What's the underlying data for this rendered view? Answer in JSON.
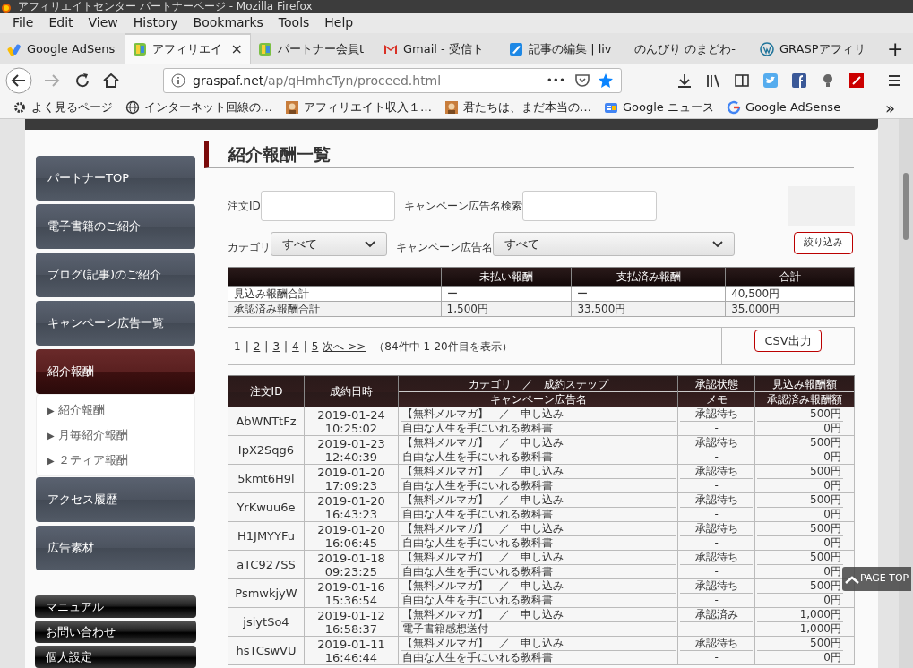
{
  "window": {
    "title": "アフィリエイトセンター パートナーページ - Mozilla Firefox"
  },
  "menu": [
    "File",
    "Edit",
    "View",
    "History",
    "Bookmarks",
    "Tools",
    "Help"
  ],
  "tabs": [
    {
      "label": "Google AdSens",
      "selected": false
    },
    {
      "label": "アフィリエイ",
      "selected": true,
      "close": "×"
    },
    {
      "label": "パートナー会員t",
      "selected": false
    },
    {
      "label": "Gmail - 受信ト",
      "selected": false
    },
    {
      "label": "記事の編集 | liv",
      "selected": false
    },
    {
      "label": "のんびり のまどわ‐",
      "selected": false
    },
    {
      "label": "GRASPアフィリ",
      "selected": false
    }
  ],
  "new_tab": "+",
  "address": {
    "host": "graspaf.net",
    "path": "/ap/qHmhcTyn/proceed.html",
    "more": "•••"
  },
  "bookmarks": [
    "よく見るページ",
    "インターネット回線の…",
    "アフィリエイト収入１…",
    "君たちは、まだ本当の…",
    "Google ニュース",
    "Google AdSense"
  ],
  "bookmarks_more": "»",
  "sidebar": {
    "items": [
      {
        "label": "パートナーTOP",
        "selected": false
      },
      {
        "label": "電子書籍のご紹介",
        "selected": false
      },
      {
        "label": "ブログ(記事)のご紹介",
        "selected": false
      },
      {
        "label": "キャンペーン広告一覧",
        "selected": false
      },
      {
        "label": "紹介報酬",
        "selected": true,
        "children": [
          "紹介報酬",
          "月毎紹介報酬",
          "２ティア報酬"
        ]
      },
      {
        "label": "アクセス履歴",
        "selected": false
      },
      {
        "label": "広告素材",
        "selected": false
      }
    ],
    "bullet": "▶",
    "footer_items": [
      "マニュアル",
      "お問い合わせ",
      "個人設定"
    ]
  },
  "heading": "紹介報酬一覧",
  "filters": {
    "order_id_label": "注文ID",
    "campaign_search_label": "キャンペーン広告名検索",
    "category_label": "カテゴリ",
    "category_value": "すべて",
    "campaign_label": "キャンペーン広告名",
    "campaign_value": "すべて",
    "submit": "絞り込み"
  },
  "summary": {
    "columns": [
      "",
      "未払い報酬",
      "支払済み報酬",
      "合計"
    ],
    "rows": [
      [
        "見込み報酬合計",
        "ー",
        "ー",
        "40,500円"
      ],
      [
        "承認済み報酬合計",
        "1,500円",
        "33,500円",
        "35,000円"
      ]
    ]
  },
  "pagination": {
    "pages": [
      {
        "label": "1",
        "selected": true
      },
      {
        "label": "2",
        "selected": false
      },
      {
        "label": "3",
        "selected": false
      },
      {
        "label": "4",
        "selected": false
      },
      {
        "label": "5",
        "selected": false
      }
    ],
    "separator": "|",
    "next": "次へ >>",
    "count": "（84件中 1-20件目を表示）",
    "csv": "CSV出力"
  },
  "table": {
    "header_rows": [
      [
        "注文ID",
        "成約日時",
        "カテゴリ　／　成約ステップ",
        "承認状態",
        "見込み報酬額"
      ],
      [
        "キャンペーン広告名",
        "メモ",
        "承認済み報酬額"
      ]
    ],
    "rows": [
      [
        [
          "AbWNTtFz"
        ],
        [
          "2019-01-24",
          "10:25:02"
        ],
        [
          "【無料メルマガ】　／　申し込み",
          "自由な人生を手にいれる教科書"
        ],
        [
          "承認待ち",
          "-"
        ],
        [
          "500円",
          "0円"
        ]
      ],
      [
        [
          "IpX2Sqg6"
        ],
        [
          "2019-01-23",
          "12:40:39"
        ],
        [
          "【無料メルマガ】　／　申し込み",
          "自由な人生を手にいれる教科書"
        ],
        [
          "承認待ち",
          "-"
        ],
        [
          "500円",
          "0円"
        ]
      ],
      [
        [
          "5kmt6H9l"
        ],
        [
          "2019-01-20",
          "17:09:23"
        ],
        [
          "【無料メルマガ】　／　申し込み",
          "自由な人生を手にいれる教科書"
        ],
        [
          "承認待ち",
          "-"
        ],
        [
          "500円",
          "0円"
        ]
      ],
      [
        [
          "YrKwuu6e"
        ],
        [
          "2019-01-20",
          "16:43:23"
        ],
        [
          "【無料メルマガ】　／　申し込み",
          "自由な人生を手にいれる教科書"
        ],
        [
          "承認待ち",
          "-"
        ],
        [
          "500円",
          "0円"
        ]
      ],
      [
        [
          "H1JMYYFu"
        ],
        [
          "2019-01-20",
          "16:06:45"
        ],
        [
          "【無料メルマガ】　／　申し込み",
          "自由な人生を手にいれる教科書"
        ],
        [
          "承認待ち",
          "-"
        ],
        [
          "500円",
          "0円"
        ]
      ],
      [
        [
          "aTC927SS"
        ],
        [
          "2019-01-18",
          "09:23:25"
        ],
        [
          "【無料メルマガ】　／　申し込み",
          "自由な人生を手にいれる教科書"
        ],
        [
          "承認待ち",
          "-"
        ],
        [
          "500円",
          "0円"
        ]
      ],
      [
        [
          "PsmwkjyW"
        ],
        [
          "2019-01-16",
          "15:36:54"
        ],
        [
          "【無料メルマガ】　／　申し込み",
          "自由な人生を手にいれる教科書"
        ],
        [
          "承認待ち",
          "-"
        ],
        [
          "500円",
          "0円"
        ]
      ],
      [
        [
          "jsiytSo4"
        ],
        [
          "2019-01-12",
          "16:58:37"
        ],
        [
          "【無料メルマガ】　／　申し込み",
          "電子書籍感想送付"
        ],
        [
          "承認済み",
          "-"
        ],
        [
          "1,000円",
          "1,000円"
        ]
      ],
      [
        [
          "hsTCswVU"
        ],
        [
          "2019-01-11",
          "16:46:44"
        ],
        [
          "【無料メルマガ】　／　申し込み",
          "自由な人生を手にいれる教科書"
        ],
        [
          "承認待ち",
          "-"
        ],
        [
          "500円",
          "0円"
        ]
      ]
    ]
  },
  "page_top": "PAGE TOP"
}
